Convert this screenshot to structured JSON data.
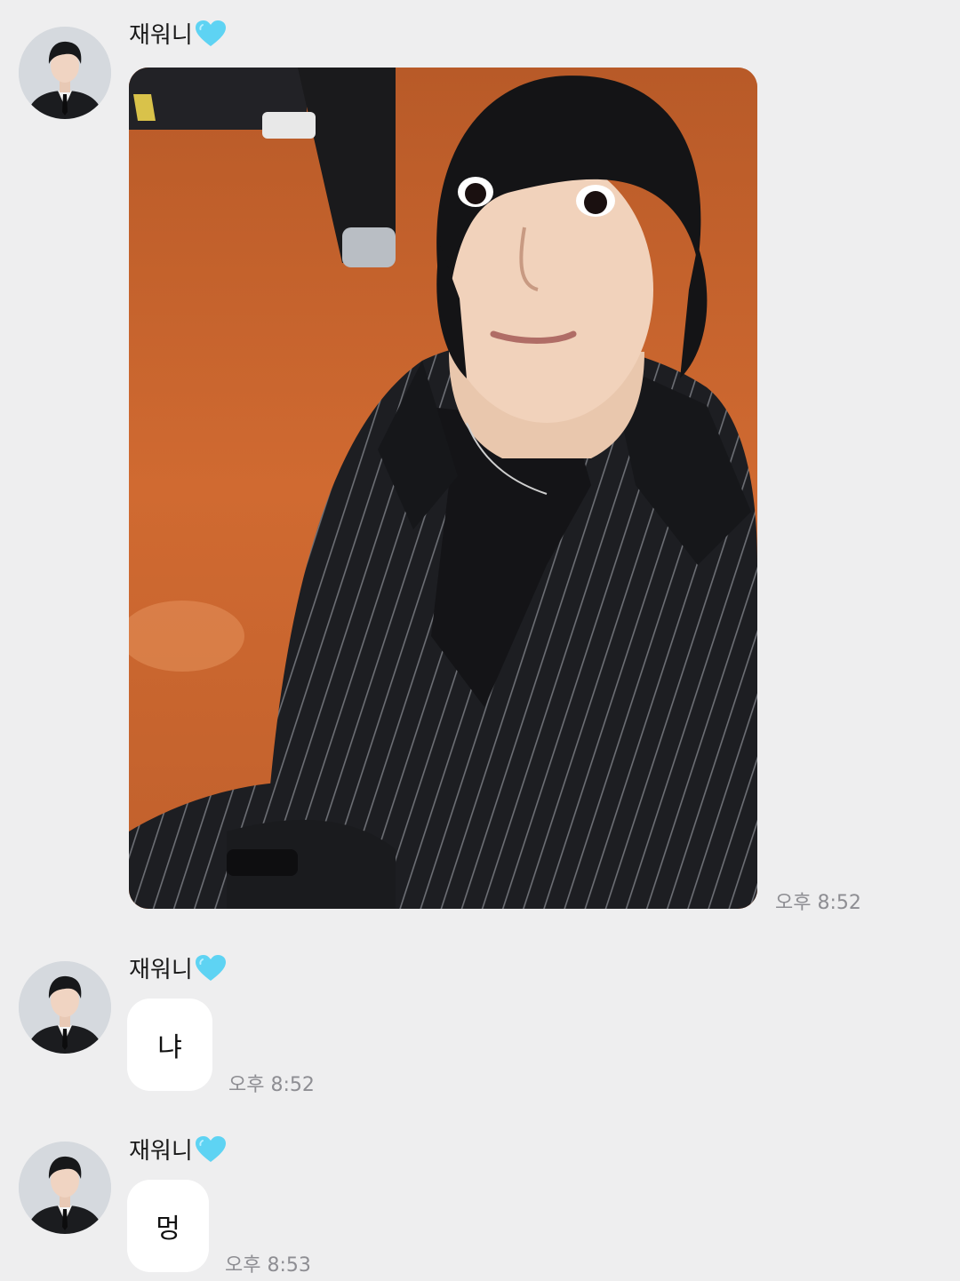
{
  "colors": {
    "background": "#eeeeef",
    "bubble": "#ffffff",
    "timestamp": "#8e8e93",
    "heart": "#5ed3f3"
  },
  "messages": [
    {
      "sender": "재워니",
      "sender_icon": "light-blue-heart-icon",
      "type": "photo",
      "time": "오후 8:52"
    },
    {
      "sender": "재워니",
      "sender_icon": "light-blue-heart-icon",
      "type": "text",
      "text": "냐",
      "time": "오후 8:52"
    },
    {
      "sender": "재워니",
      "sender_icon": "light-blue-heart-icon",
      "type": "text",
      "text": "멍",
      "time": "오후 8:53"
    }
  ]
}
